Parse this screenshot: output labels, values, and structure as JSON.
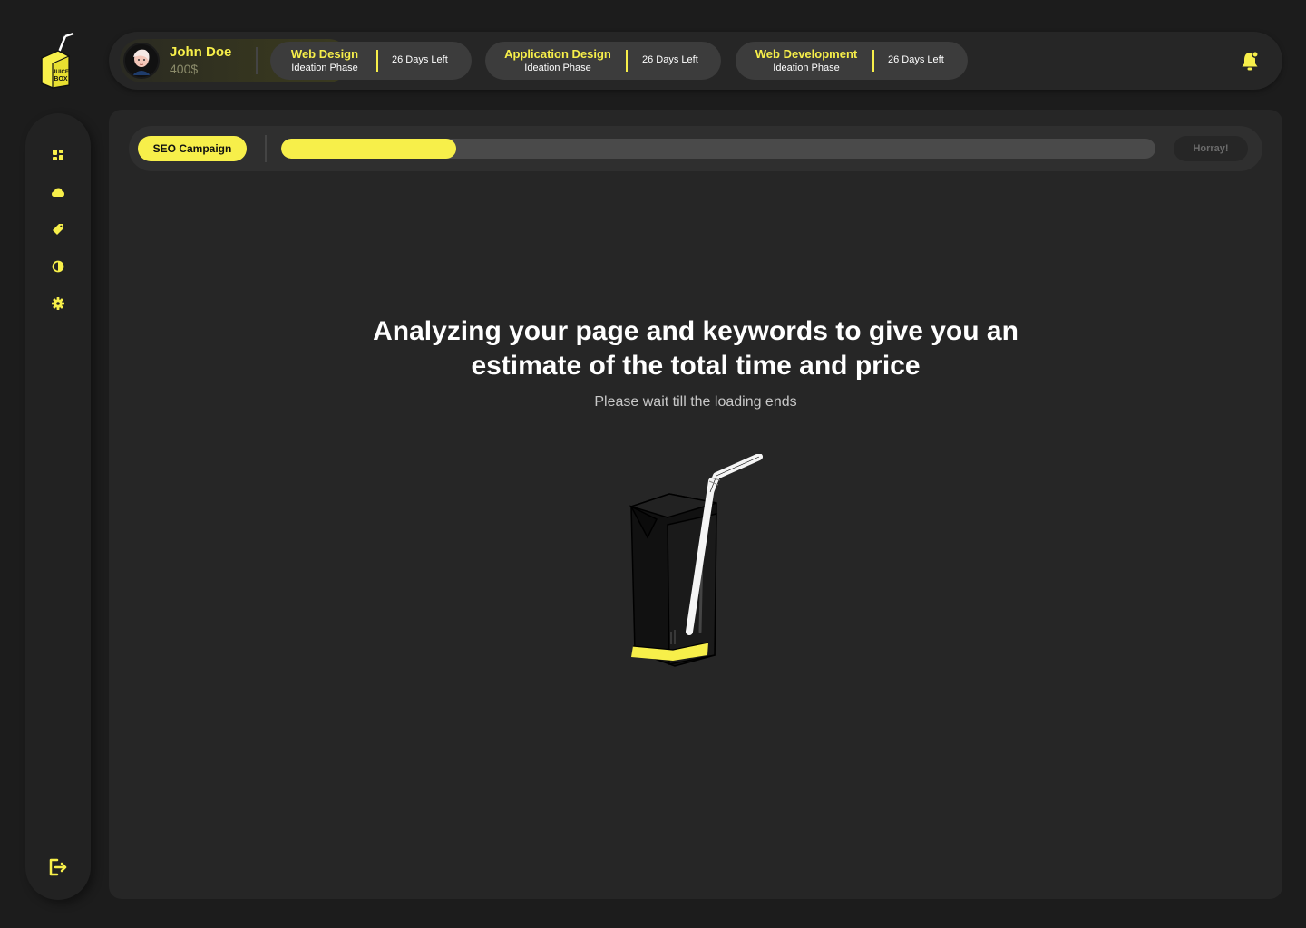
{
  "logo": {
    "text_top": "JUICE",
    "text_bottom": "BOX"
  },
  "user": {
    "name": "John Doe",
    "balance": "400$"
  },
  "projects": [
    {
      "name": "Web Design",
      "phase": "Ideation Phase",
      "days_left": "26 Days Left"
    },
    {
      "name": "Application Design",
      "phase": "Ideation Phase",
      "days_left": "26 Days Left"
    },
    {
      "name": "Web Development",
      "phase": "Ideation Phase",
      "days_left": "26 Days Left"
    }
  ],
  "sidebar": {
    "items": [
      {
        "icon": "dashboard-icon"
      },
      {
        "icon": "cloud-icon"
      },
      {
        "icon": "tag-icon"
      },
      {
        "icon": "contrast-icon"
      },
      {
        "icon": "gear-icon"
      }
    ],
    "logout_icon": "logout-icon"
  },
  "campaign": {
    "label": "SEO Campaign",
    "progress": 0.2,
    "end_label": "Horray!"
  },
  "loading": {
    "headline_line1": "Analyzing your page and keywords to give you an",
    "headline_line2": "estimate of the total time and price",
    "subtext": "Please wait till the loading ends"
  },
  "colors": {
    "accent": "#f7ef4a",
    "background": "#1c1c1c",
    "panel": "#262626"
  }
}
